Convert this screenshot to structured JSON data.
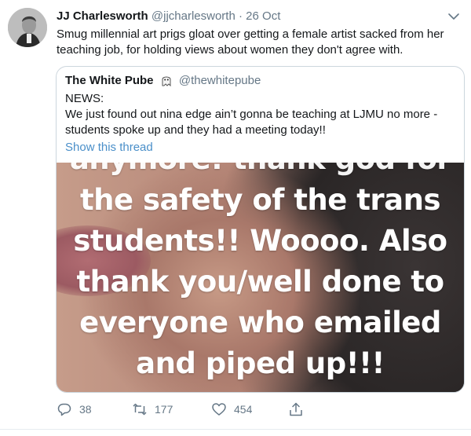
{
  "tweet": {
    "author_name": "JJ Charlesworth",
    "handle": "@jjcharlesworth",
    "separator": "·",
    "date": "26 Oct",
    "text": "Smug millennial art prigs gloat over getting a female artist sacked from her teaching job, for holding views about women they don't agree with."
  },
  "quoted": {
    "author_name": "The White Pube",
    "handle": "@thewhitepube",
    "text_line1": "NEWS:",
    "text_line2": "We just found out nina edge ain’t gonna be teaching at LJMU no more - students spoke up and they had a meeting today!!",
    "show_thread": "Show this thread",
    "image_text": [
      "anymore! thank god for",
      "the safety of the trans",
      "students!! Woooo. Also",
      "thank you/well done to",
      "everyone who emailed",
      "and piped up!!!"
    ]
  },
  "actions": {
    "replies": "38",
    "retweets": "177",
    "likes": "454"
  },
  "colors": {
    "text": "#14171a",
    "muted": "#657786",
    "link": "#4a8fc9",
    "border": "#ccd6dd"
  }
}
